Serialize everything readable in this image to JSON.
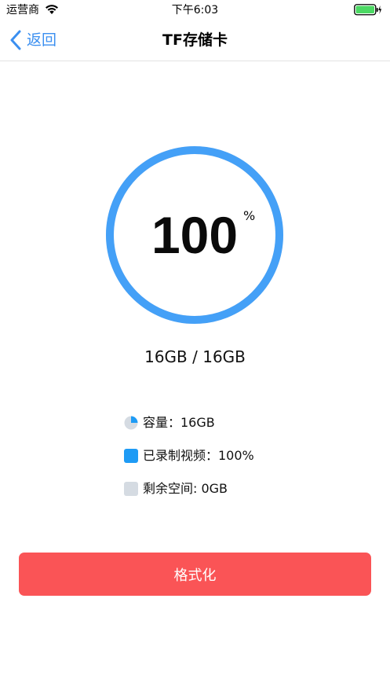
{
  "status_bar": {
    "carrier": "运营商",
    "time": "下午6:03",
    "battery_color": "#4cd964"
  },
  "nav": {
    "back_label": "返回",
    "title": "TF存储卡",
    "accent_color": "#3b8ff0"
  },
  "storage": {
    "percent_value": "100",
    "percent_unit": "%",
    "usage_fraction": 1.0,
    "usage_text": "16GB / 16GB",
    "ring_color": "#44a0f7",
    "ring_track_color": "#d9dee4"
  },
  "legend": {
    "capacity": {
      "text": "容量：16GB",
      "icon": "pie-chart-icon"
    },
    "recorded": {
      "text": "已录制视频：100%",
      "color": "#1e9bf5"
    },
    "remaining": {
      "text": "剩余空间: 0GB",
      "color": "#d5dbe2"
    }
  },
  "actions": {
    "format_label": "格式化",
    "format_color": "#fa5456"
  }
}
